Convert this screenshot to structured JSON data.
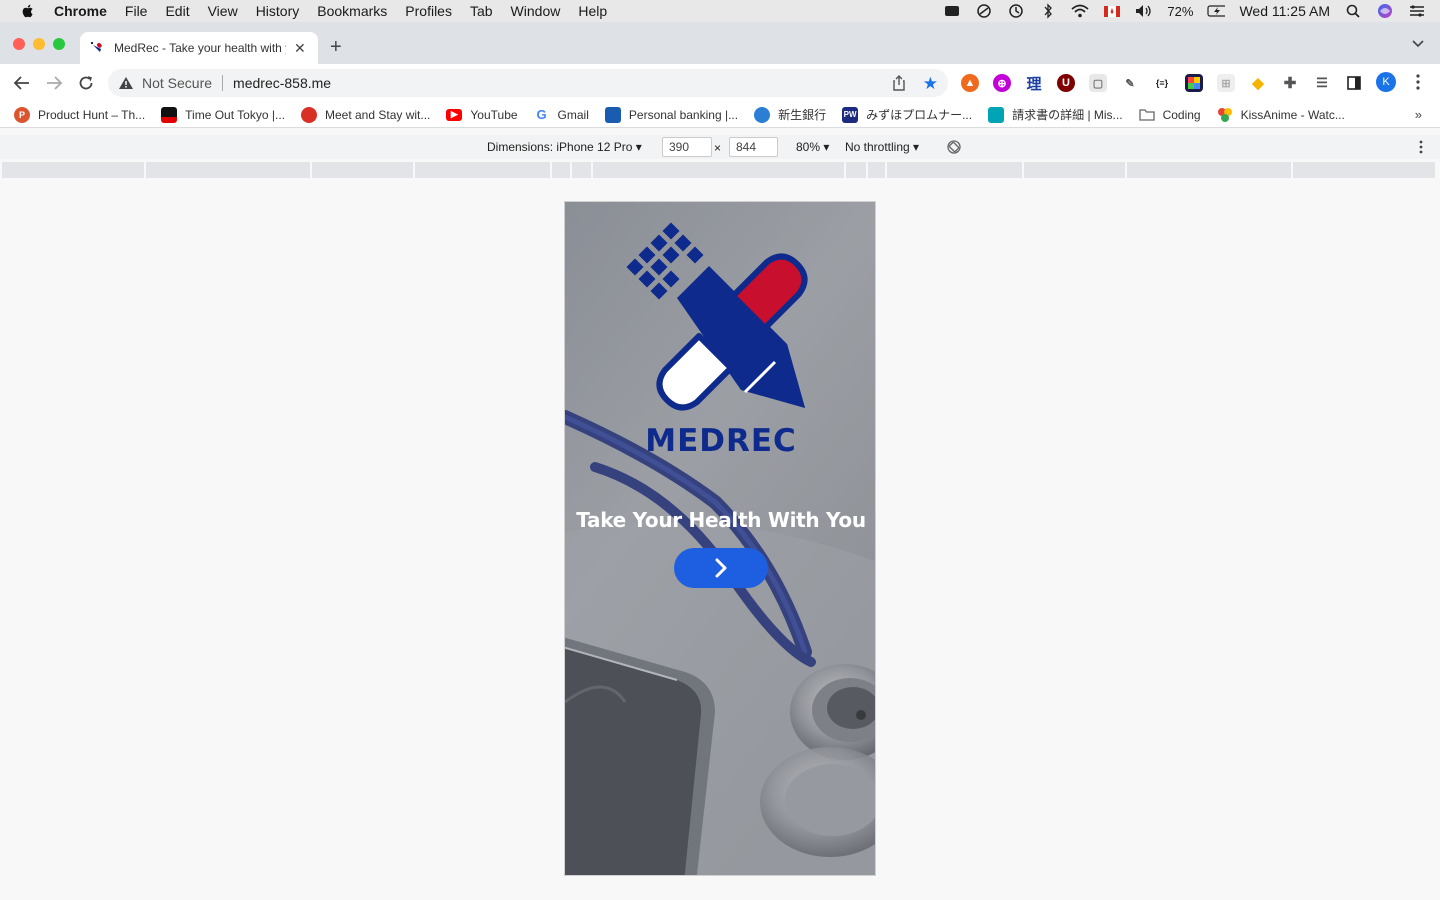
{
  "menubar": {
    "app": "Chrome",
    "items": [
      "File",
      "Edit",
      "View",
      "History",
      "Bookmarks",
      "Profiles",
      "Tab",
      "Window",
      "Help"
    ],
    "battery": "72%",
    "clock": "Wed 11:25 AM"
  },
  "tab": {
    "title": "MedRec - Take your health with you",
    "new_tab_label": "+"
  },
  "toolbar": {
    "security_label": "Not Secure",
    "url": "medrec-858.me",
    "profile_initial": "K"
  },
  "bookmarks": [
    {
      "label": "Product Hunt – Th...",
      "color": "#da552f",
      "glyph": "P"
    },
    {
      "label": "Time Out Tokyo |...",
      "color": "#e00000",
      "glyph": ""
    },
    {
      "label": "Meet and Stay wit...",
      "color": "#d93025",
      "glyph": ""
    },
    {
      "label": "YouTube",
      "color": "#ff0000",
      "glyph": "▶"
    },
    {
      "label": "Gmail",
      "color": "#4285f4",
      "glyph": "G"
    },
    {
      "label": "Personal banking |...",
      "color": "#1a5cb0",
      "glyph": ""
    },
    {
      "label": "新生銀行",
      "color": "#2a7fd4",
      "glyph": ""
    },
    {
      "label": "みずほプロムナー...",
      "color": "#1c2a80",
      "glyph": "PW"
    },
    {
      "label": "請求書の詳細 | Mis...",
      "color": "#00a4b4",
      "glyph": ""
    },
    {
      "label": "Coding",
      "color": "#777777",
      "glyph": ""
    },
    {
      "label": "KissAnime - Watc...",
      "color": "#34a853",
      "glyph": ""
    }
  ],
  "device_toolbar": {
    "dimensions": "Dimensions: iPhone 12 Pro ▾",
    "width": "390",
    "height": "844",
    "times": "×",
    "zoom": "80% ▾",
    "throttling": "No throttling ▾"
  },
  "app": {
    "brand": "MEDREC",
    "tagline": "Take Your Health With You"
  },
  "colors": {
    "brand_navy": "#0d2a8c",
    "brand_red": "#c8102e",
    "button_blue": "#1d5fe0"
  }
}
